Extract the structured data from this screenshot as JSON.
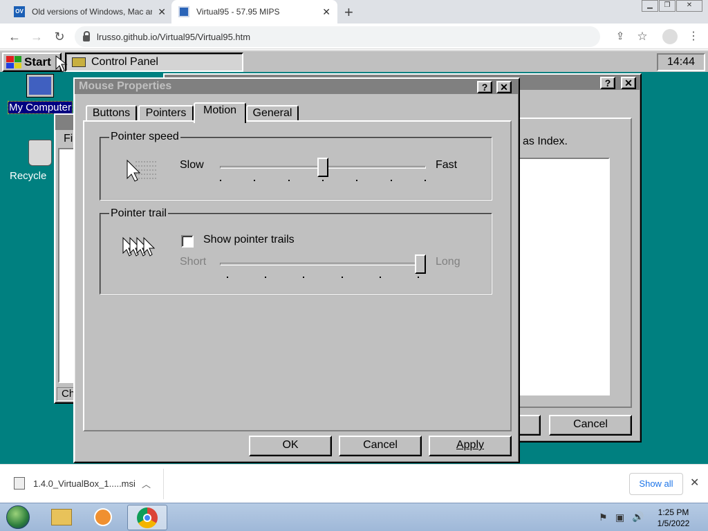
{
  "browser": {
    "tabs": [
      {
        "label": "Old versions of Windows, Mac an",
        "favicon": "OV"
      },
      {
        "label": "Virtual95 - 57.95 MIPS"
      }
    ],
    "url": "lrusso.github.io/Virtual95/Virtual95.htm"
  },
  "win95": {
    "start_label": "Start",
    "taskbar_item": "Control Panel",
    "clock": "14:44",
    "desktop_icons": [
      "My Computer",
      "Recycle"
    ],
    "bg_window": {
      "text": "as Index.",
      "cancel": "Cancel"
    },
    "left_window": {
      "menu": "Fi",
      "status": "Ch"
    },
    "dialog": {
      "title": "Mouse Properties",
      "tabs": [
        "Buttons",
        "Pointers",
        "Motion",
        "General"
      ],
      "active_tab": "Motion",
      "speed": {
        "label": "Pointer speed",
        "min": "Slow",
        "max": "Fast",
        "value": 0.5
      },
      "trail": {
        "label": "Pointer trail",
        "checkbox": "Show pointer trails",
        "checked": false,
        "min": "Short",
        "max": "Long",
        "value": 1.0
      },
      "buttons": {
        "ok": "OK",
        "cancel": "Cancel",
        "apply": "Apply"
      }
    }
  },
  "download": {
    "file": "1.4.0_VirtualBox_1.....msi",
    "show_all": "Show all"
  },
  "win7": {
    "time": "1:25 PM",
    "date": "1/5/2022"
  }
}
